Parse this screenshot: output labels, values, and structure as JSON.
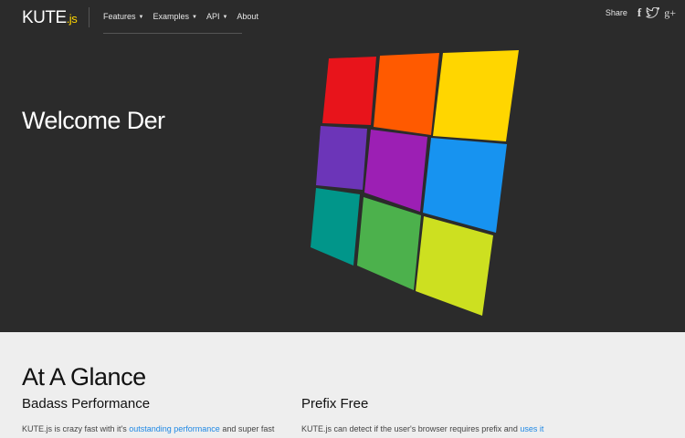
{
  "header": {
    "logo_main": "KUTE",
    "logo_suffix": ".js",
    "nav": [
      {
        "label": "Features",
        "has_dropdown": true
      },
      {
        "label": "Examples",
        "has_dropdown": true
      },
      {
        "label": "API",
        "has_dropdown": true
      },
      {
        "label": "About",
        "has_dropdown": false
      }
    ],
    "share": {
      "label": "Share",
      "icons": [
        "facebook-icon",
        "twitter-icon",
        "google-plus-icon"
      ],
      "facebook_glyph": "f",
      "google_plus_glyph": "g+"
    }
  },
  "hero": {
    "title": "Welcome Der",
    "tiles": [
      {
        "color": "#e8141b"
      },
      {
        "color": "#ff5a00"
      },
      {
        "color": "#ffd600"
      },
      {
        "color": "#6c35b8"
      },
      {
        "color": "#9c1fb4"
      },
      {
        "color": "#1793f0"
      },
      {
        "color": "#01968a"
      },
      {
        "color": "#4cb14c"
      },
      {
        "color": "#cde020"
      }
    ]
  },
  "glance": {
    "title": "At A Glance",
    "columns": [
      {
        "title": "Badass Performance",
        "text_before": "KUTE.js is crazy fast with it's ",
        "link": "outstanding performance",
        "text_after": " and super fast"
      },
      {
        "title": "Prefix Free",
        "text_before": "KUTE.js can detect if the user's browser requires prefix and ",
        "link": "uses it",
        "text_after": ""
      }
    ]
  },
  "colors": {
    "hero_bg": "#2b2b2b",
    "content_bg": "#eeeeee",
    "link": "#1e88e5",
    "logo_accent": "#ffd600"
  }
}
